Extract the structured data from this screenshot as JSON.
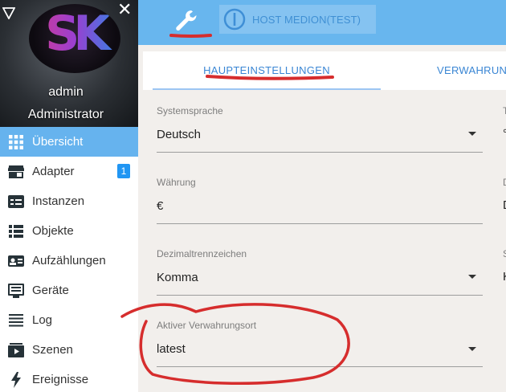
{
  "sidebar": {
    "user_name": "admin",
    "user_role": "Administrator",
    "logo_text": "SK",
    "items": [
      {
        "label": "Übersicht",
        "icon": "grid-icon",
        "active": true
      },
      {
        "label": "Adapter",
        "icon": "store-icon",
        "badge": "1"
      },
      {
        "label": "Instanzen",
        "icon": "instances-icon"
      },
      {
        "label": "Objekte",
        "icon": "list-icon"
      },
      {
        "label": "Aufzählungen",
        "icon": "enum-icon"
      },
      {
        "label": "Geräte",
        "icon": "devices-icon"
      },
      {
        "label": "Log",
        "icon": "log-icon"
      },
      {
        "label": "Szenen",
        "icon": "scenes-icon"
      },
      {
        "label": "Ereignisse",
        "icon": "lightning-icon"
      }
    ]
  },
  "topbar": {
    "host_label": "HOST MEDION(TEST)"
  },
  "tabs": [
    {
      "label": "HAUPTEINSTELLUNGEN",
      "active": true
    },
    {
      "label": "VERWAHRUN"
    }
  ],
  "fields": {
    "systemsprache": {
      "label": "Systemsprache",
      "value": "Deutsch"
    },
    "waehrung": {
      "label": "Währung",
      "value": "€"
    },
    "dezimal": {
      "label": "Dezimaltrennzeichen",
      "value": "Komma"
    },
    "verwahrungsort": {
      "label": "Aktiver Verwahrungsort",
      "value": "latest"
    }
  },
  "side_column": {
    "labels": [
      "T",
      "D",
      "S"
    ],
    "values": [
      "°",
      "D",
      "K"
    ]
  },
  "colors": {
    "accent": "#66b3ee",
    "annotation": "#d62d2d"
  }
}
